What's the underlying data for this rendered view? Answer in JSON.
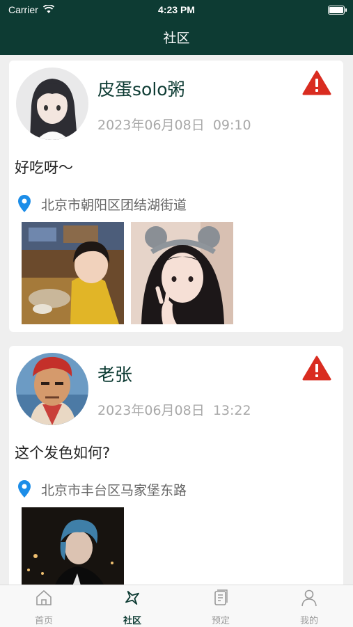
{
  "status_bar": {
    "carrier": "Carrier",
    "time": "4:23 PM"
  },
  "nav": {
    "title": "社区"
  },
  "posts": [
    {
      "username": "皮蛋solo粥",
      "date": "2023年06月08日",
      "time": "09:10",
      "content": "好吃呀～",
      "location": "北京市朝阳区团结湖街道",
      "photo_count": 2
    },
    {
      "username": "老张",
      "date": "2023年06月08日",
      "time": "13:22",
      "content": "这个发色如何?",
      "location": "北京市丰台区马家堡东路",
      "photo_count": 1
    }
  ],
  "tabs": [
    {
      "label": "首页",
      "icon": "home-icon",
      "active": false
    },
    {
      "label": "社区",
      "icon": "airplane-icon",
      "active": true
    },
    {
      "label": "预定",
      "icon": "booking-icon",
      "active": false
    },
    {
      "label": "我的",
      "icon": "person-icon",
      "active": false
    }
  ],
  "colors": {
    "header": "#0d3b33",
    "warning": "#d92c20",
    "location": "#1c8de8",
    "accent": "#0d3b33"
  }
}
